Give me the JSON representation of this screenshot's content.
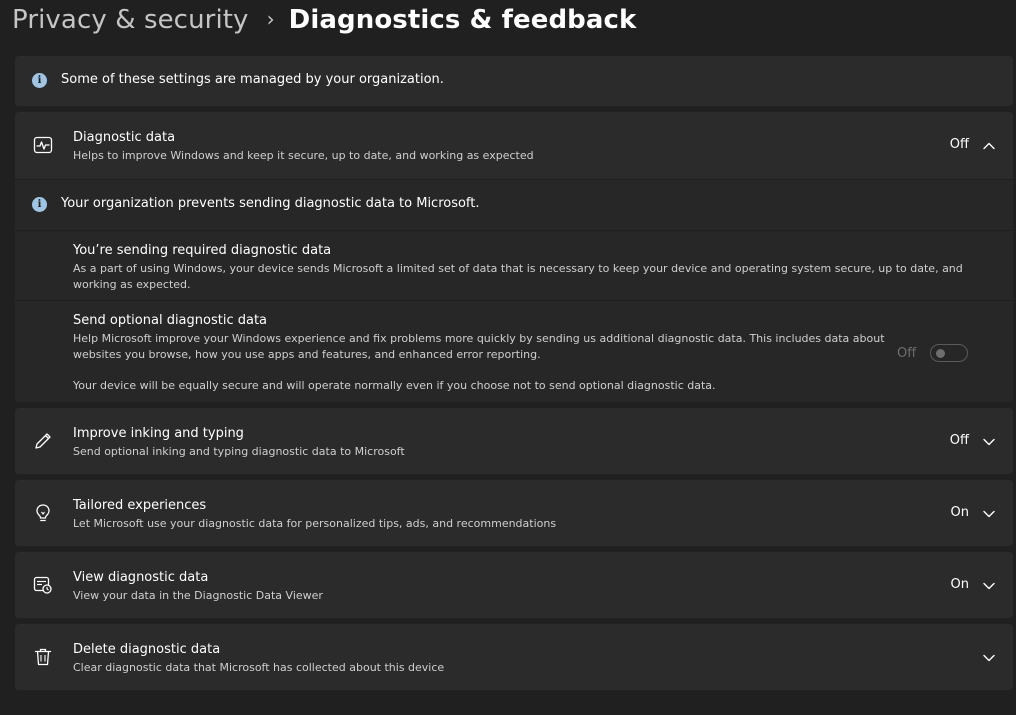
{
  "breadcrumb": {
    "parent": "Privacy & security",
    "separator": "›",
    "current": "Diagnostics & feedback"
  },
  "notice": {
    "text": "Some of these settings are managed by your organization."
  },
  "diagnostic_data": {
    "title": "Diagnostic data",
    "description": "Helps to improve Windows and keep it secure, up to date, and working as expected",
    "state": "Off",
    "org_notice": "Your organization prevents sending diagnostic data to Microsoft.",
    "required": {
      "title": "You’re sending required diagnostic data",
      "description": "As a part of using Windows, your device sends Microsoft a limited set of data that is necessary to keep your device and operating system secure, up to date, and working as expected."
    },
    "optional": {
      "title": "Send optional diagnostic data",
      "description": "Help Microsoft improve your Windows experience and fix problems more quickly by sending us additional diagnostic data. This includes data about websites you browse, how you use apps and features, and enhanced error reporting.",
      "note": "Your device will be equally secure and will operate normally even if you choose not to send optional diagnostic data.",
      "toggle_label": "Off"
    }
  },
  "inking": {
    "title": "Improve inking and typing",
    "description": "Send optional inking and typing diagnostic data to Microsoft",
    "state": "Off"
  },
  "tailored": {
    "title": "Tailored experiences",
    "description": "Let Microsoft use your diagnostic data for personalized tips, ads, and recommendations",
    "state": "On"
  },
  "view_data": {
    "title": "View diagnostic data",
    "description": "View your data in the Diagnostic Data Viewer",
    "state": "On"
  },
  "delete_data": {
    "title": "Delete diagnostic data",
    "description": "Clear diagnostic data that Microsoft has collected about this device"
  },
  "colors": {
    "background": "#202020",
    "card": "#2b2b2b",
    "info_icon": "#a0c4e4"
  }
}
